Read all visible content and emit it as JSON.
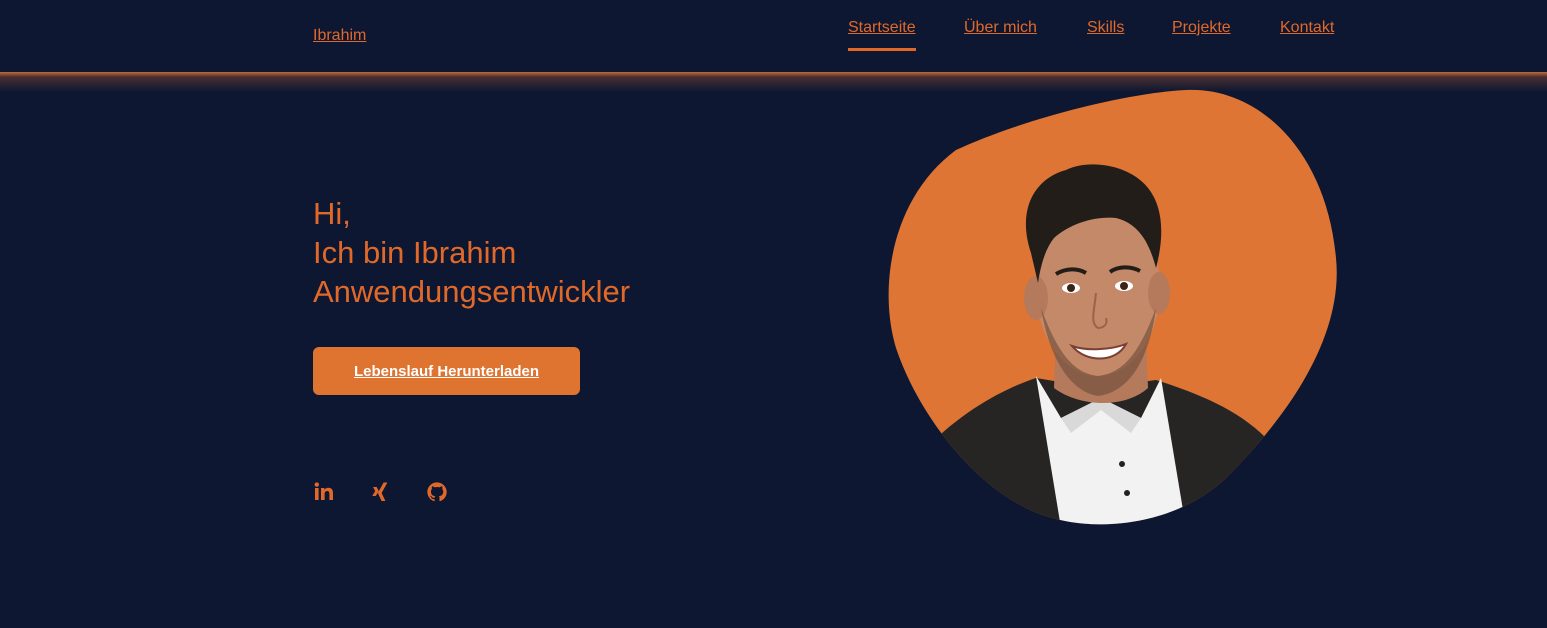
{
  "header": {
    "logo": "Ibrahim",
    "nav": [
      {
        "label": "Startseite",
        "active": true
      },
      {
        "label": "Über mich",
        "active": false
      },
      {
        "label": "Skills",
        "active": false
      },
      {
        "label": "Projekte",
        "active": false
      },
      {
        "label": "Kontakt",
        "active": false
      }
    ]
  },
  "hero": {
    "greeting": "Hi,",
    "intro": "Ich bin Ibrahim",
    "role": "Anwendungsentwickler",
    "cv_button": "Lebenslauf Herunterladen"
  },
  "social": [
    "linkedin-icon",
    "xing-icon",
    "github-icon"
  ],
  "colors": {
    "background": "#0d1731",
    "accent": "#e0692a",
    "button": "#df7431",
    "button_text": "#ffffff"
  }
}
